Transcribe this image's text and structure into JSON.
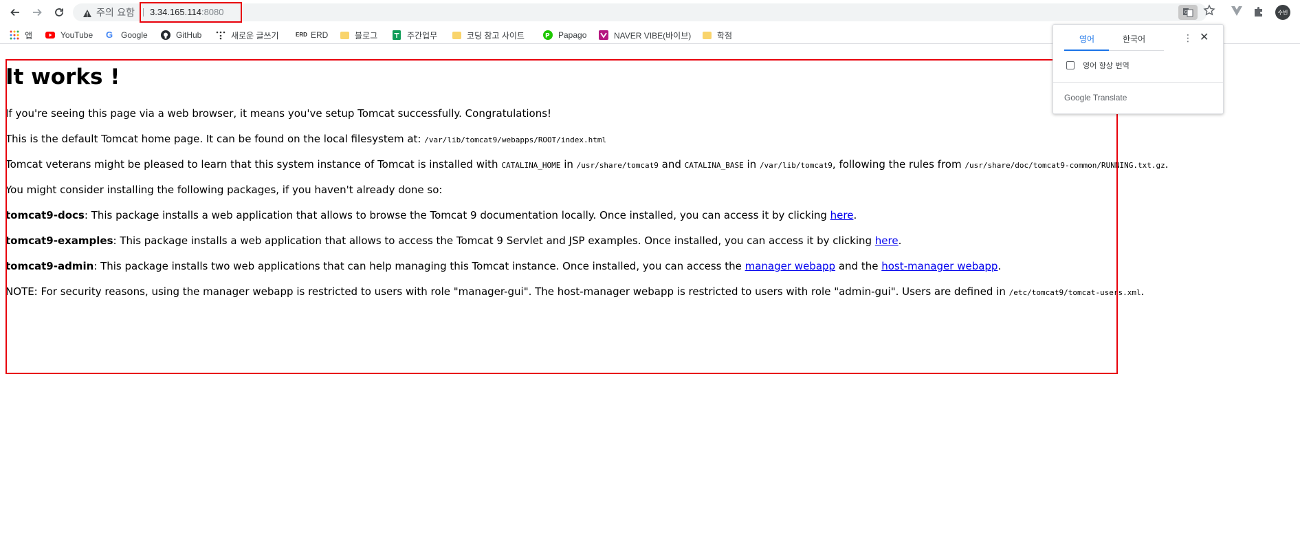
{
  "browser": {
    "back_label": "Back",
    "security_warning": "주의 요함",
    "url_host": "3.34.165.114",
    "url_port": ":8080",
    "avatar_initials": "수빈"
  },
  "bookmarks": [
    {
      "label": "앱",
      "icon": "apps-grid-icon"
    },
    {
      "label": "YouTube",
      "icon": "youtube-icon"
    },
    {
      "label": "Google",
      "icon": "google-icon"
    },
    {
      "label": "GitHub",
      "icon": "github-icon"
    },
    {
      "label": "새로운 글쓰기",
      "icon": "dots-icon"
    },
    {
      "label": "ERD",
      "icon": "erd-icon"
    },
    {
      "label": "블로그",
      "icon": "folder-icon"
    },
    {
      "label": "주간업무",
      "icon": "sheets-icon"
    },
    {
      "label": "코딩 참고 사이트",
      "icon": "folder-icon"
    },
    {
      "label": "Papago",
      "icon": "papago-icon"
    },
    {
      "label": "NAVER VIBE(바이브)",
      "icon": "vibe-icon"
    },
    {
      "label": "학점",
      "icon": "folder-icon"
    }
  ],
  "page": {
    "title": "It works !",
    "p1": "If you're seeing this page via a web browser, it means you've setup Tomcat successfully. Congratulations!",
    "p2_text": "This is the default Tomcat home page. It can be found on the local filesystem at: ",
    "p2_code": "/var/lib/tomcat9/webapps/ROOT/index.html",
    "p3_a": "Tomcat veterans might be pleased to learn that this system instance of Tomcat is installed with ",
    "p3_code1": "CATALINA_HOME",
    "p3_b": " in ",
    "p3_code2": "/usr/share/tomcat9",
    "p3_c": " and ",
    "p3_code3": "CATALINA_BASE",
    "p3_d": " in ",
    "p3_code4": "/var/lib/tomcat9",
    "p3_e": ", following the rules from ",
    "p3_code5": "/usr/share/doc/tomcat9-common/RUNNING.txt.gz",
    "p3_f": ".",
    "p4": "You might consider installing the following packages, if you haven't already done so:",
    "p5_bold": "tomcat9-docs",
    "p5_text": ": This package installs a web application that allows to browse the Tomcat 9 documentation locally. Once installed, you can access it by clicking ",
    "p5_link": "here",
    "p5_end": ".",
    "p6_bold": "tomcat9-examples",
    "p6_text": ": This package installs a web application that allows to access the Tomcat 9 Servlet and JSP examples. Once installed, you can access it by clicking ",
    "p6_link": "here",
    "p6_end": ".",
    "p7_bold": "tomcat9-admin",
    "p7_text": ": This package installs two web applications that can help managing this Tomcat instance. Once installed, you can access the ",
    "p7_link1": "manager webapp",
    "p7_mid": " and the ",
    "p7_link2": "host-manager webapp",
    "p7_end": ".",
    "p8_text": "NOTE: For security reasons, using the manager webapp is restricted to users with role \"manager-gui\". The host-manager webapp is restricted to users with role \"admin-gui\". Users are defined in ",
    "p8_code": "/etc/tomcat9/tomcat-users.xml",
    "p8_end": "."
  },
  "translate_popup": {
    "tab_source": "영어",
    "tab_target": "한국어",
    "always_translate": "영어 항상 번역",
    "brand_google": "Google",
    "brand_translate": "Translate"
  },
  "colors": {
    "highlight_border": "#e8000b",
    "link": "#0000ee",
    "accent": "#1a73e8"
  }
}
